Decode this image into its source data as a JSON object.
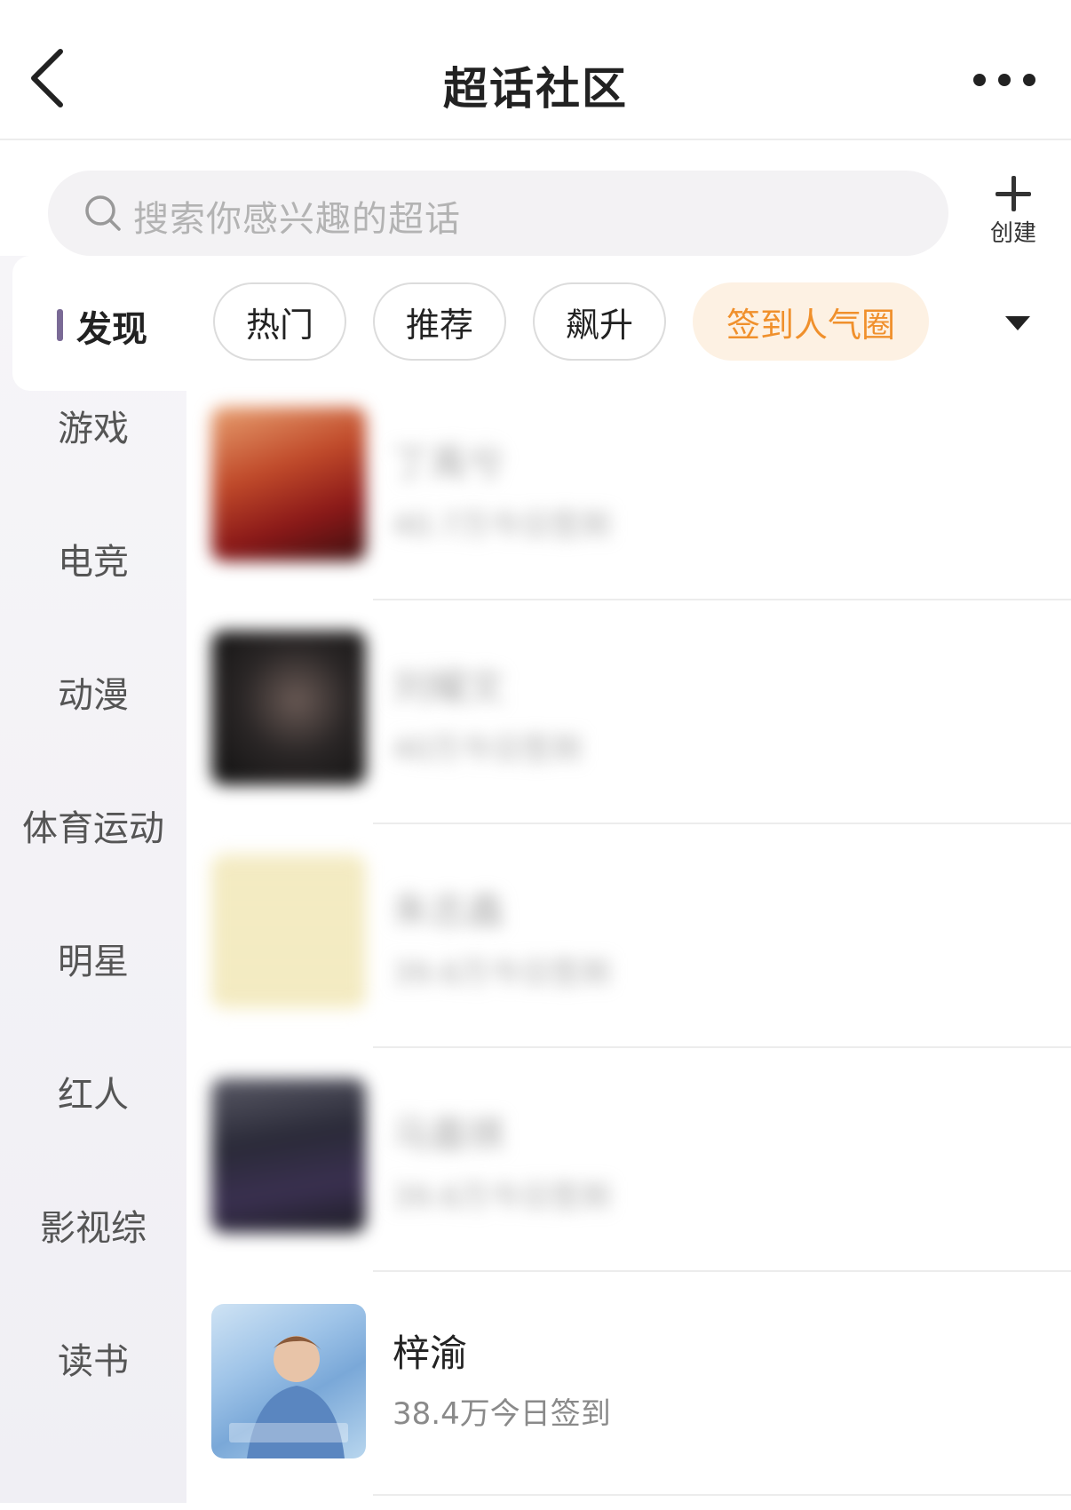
{
  "header": {
    "title": "超话社区"
  },
  "search": {
    "placeholder": "搜索你感兴趣的超话",
    "create_label": "创建"
  },
  "sidebar": {
    "active": "发现",
    "items": [
      "游戏",
      "电竞",
      "动漫",
      "体育运动",
      "明星",
      "红人",
      "影视综",
      "读书"
    ]
  },
  "tabs": [
    {
      "label": "热门",
      "active": false
    },
    {
      "label": "推荐",
      "active": false
    },
    {
      "label": "飙升",
      "active": false
    },
    {
      "label": "签到人气圈",
      "active": true
    }
  ],
  "list": [
    {
      "name": "丁禹兮",
      "sub": "40.7万今日签到",
      "blurred": true
    },
    {
      "name": "刘耀文",
      "sub": "40万今日签到",
      "blurred": true
    },
    {
      "name": "朱志鑫",
      "sub": "39.6万今日签到",
      "blurred": true
    },
    {
      "name": "马嘉祺",
      "sub": "39.6万今日签到",
      "blurred": true
    },
    {
      "name": "梓渝",
      "sub": "38.4万今日签到",
      "blurred": false
    }
  ],
  "colors": {
    "accent": "#f0902c",
    "accent_bg": "#fdf1e3",
    "sidebar_bar": "#7a6a96"
  }
}
